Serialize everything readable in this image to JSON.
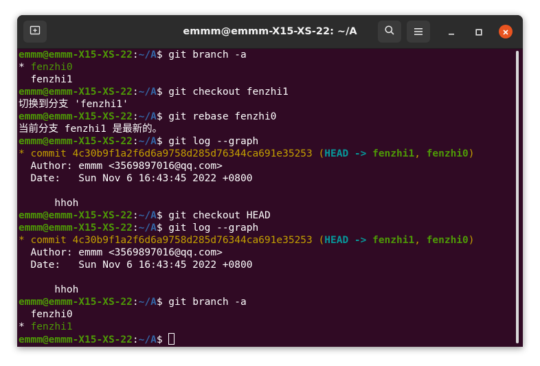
{
  "window": {
    "title": "emmm@emmm-X15-XS-22: ~/A",
    "new_tab_icon": "new-tab-icon",
    "search_icon": "search-icon",
    "menu_icon": "hamburger-menu-icon",
    "minimize_icon": "minimize-icon",
    "maximize_icon": "maximize-icon",
    "close_icon": "close-icon",
    "accent": "#e95420",
    "terminal_bg": "#300a24"
  },
  "prompt": {
    "user_host": "emmm@emmm-X15-XS-22",
    "colon": ":",
    "path": "~/A",
    "dollar": "$ "
  },
  "commands": {
    "c1": "git branch -a",
    "c2": "git checkout fenzhi1",
    "c3": "git rebase fenzhi0",
    "c4": "git log --graph",
    "c5": "git checkout HEAD",
    "c6": "git log --graph",
    "c7": "git branch -a"
  },
  "output": {
    "o1_star": "* ",
    "o1_branch": "fenzhi0",
    "o2": "  fenzhi1",
    "o3": "切换到分支 'fenzhi1'",
    "o4": "当前分支 fenzhi1 是最新的。",
    "log1": {
      "star": "* ",
      "commit": "commit 4c30b9f1a2f6d6a9758d285d76344ca691e35253",
      "open": " (",
      "head": "HEAD -> ",
      "b1": "fenzhi1",
      "comma": ", ",
      "b2": "fenzhi0",
      "close": ")",
      "author": "  Author: emmm <3569897016@qq.com>",
      "date": "  Date:   Sun Nov 6 16:43:45 2022 +0800",
      "blank": " ",
      "message": "      hhoh"
    },
    "log2": {
      "star": "* ",
      "commit": "commit 4c30b9f1a2f6d6a9758d285d76344ca691e35253",
      "open": " (",
      "head": "HEAD -> ",
      "b1": "fenzhi1",
      "comma": ", ",
      "b2": "fenzhi0",
      "close": ")",
      "author": "  Author: emmm <3569897016@qq.com>",
      "date": "  Date:   Sun Nov 6 16:43:45 2022 +0800",
      "blank": " ",
      "message": "      hhoh"
    },
    "o5": "  fenzhi0",
    "o6_star": "* ",
    "o6_branch": "fenzhi1"
  }
}
